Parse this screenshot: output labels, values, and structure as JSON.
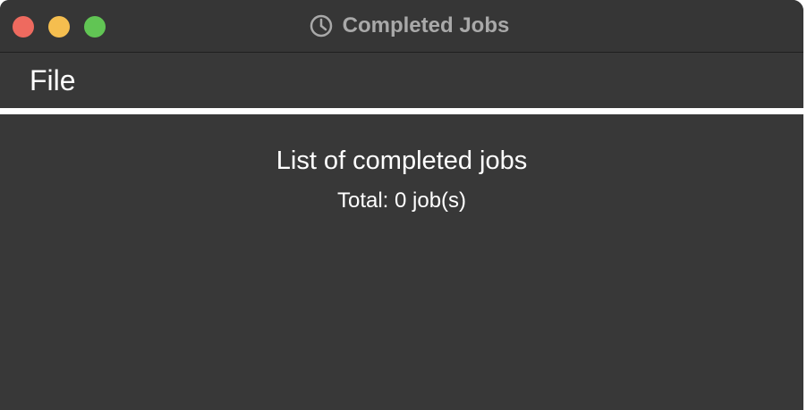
{
  "window": {
    "title": "Completed Jobs",
    "title_icon": "clock-icon",
    "traffic_lights": {
      "close_color": "#ee6a5f",
      "minimize_color": "#f5be4f",
      "zoom_color": "#61c554"
    }
  },
  "menu": {
    "items": [
      {
        "label": "File"
      }
    ]
  },
  "content": {
    "heading": "List of completed jobs",
    "total_label": "Total: 0 job(s)"
  }
}
